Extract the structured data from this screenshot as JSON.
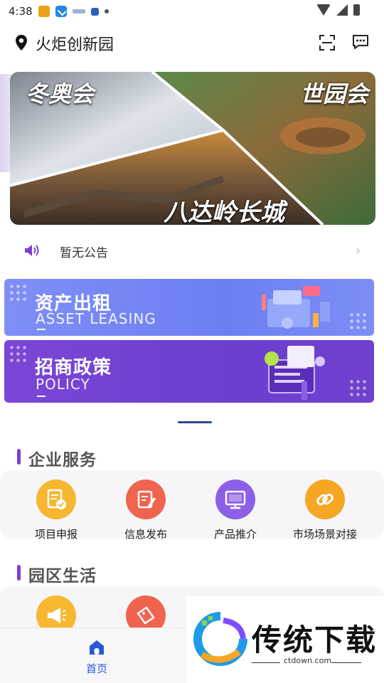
{
  "status_bar": {
    "time": "4:38"
  },
  "header": {
    "title": "火炬创新园"
  },
  "banner": {
    "labels": [
      "冬奥会",
      "世园会",
      "八达岭长城"
    ]
  },
  "notice": {
    "text": "暂无公告"
  },
  "promos": [
    {
      "title": "资产出租",
      "subtitle": "ASSET LEASING",
      "color": "#7082f4"
    },
    {
      "title": "招商政策",
      "subtitle": "POLICY",
      "color": "#6d40d1"
    }
  ],
  "sections": {
    "enterprise": {
      "title": "企业服务",
      "items": [
        {
          "label": "项目申报",
          "icon": "document-check-icon",
          "color": "#f5b82e"
        },
        {
          "label": "信息发布",
          "icon": "edit-document-icon",
          "color": "#f0634e"
        },
        {
          "label": "产品推介",
          "icon": "monitor-icon",
          "color": "#8b5fe6"
        },
        {
          "label": "市场场景对接",
          "icon": "link-icon",
          "color": "#f5a623"
        }
      ]
    },
    "park_life": {
      "title": "园区生活",
      "items": [
        {
          "icon": "megaphone-icon",
          "color": "#f5b82e"
        },
        {
          "icon": "ticket-icon",
          "color": "#f0634e"
        }
      ]
    }
  },
  "tabbar": {
    "home_label": "首页"
  },
  "watermark": {
    "text": "传统下载",
    "url": "ctdown.com"
  }
}
